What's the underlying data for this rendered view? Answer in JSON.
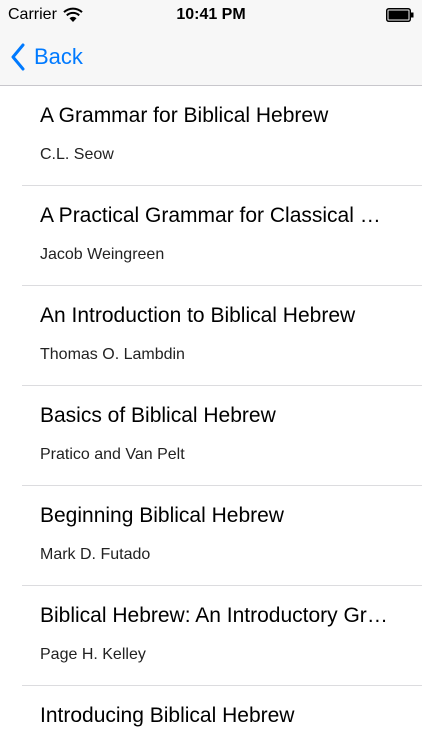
{
  "status_bar": {
    "carrier": "Carrier",
    "time": "10:41 PM",
    "wifi_icon": "wifi-icon",
    "battery_icon": "battery-icon"
  },
  "nav": {
    "back_label": "Back",
    "back_icon": "chevron-left-icon",
    "accent_color": "#007aff"
  },
  "books": [
    {
      "title": "A Grammar for Biblical Hebrew",
      "author": "C.L. Seow"
    },
    {
      "title": "A Practical Grammar for Classical Hebrew",
      "author": "Jacob Weingreen"
    },
    {
      "title": "An Introduction to Biblical Hebrew",
      "author": "Thomas O. Lambdin"
    },
    {
      "title": "Basics of Biblical Hebrew",
      "author": "Pratico and Van Pelt"
    },
    {
      "title": "Beginning Biblical Hebrew",
      "author": "Mark D. Futado"
    },
    {
      "title": "Biblical Hebrew: An Introductory Grammar",
      "author": "Page H. Kelley"
    },
    {
      "title": "Introducing Biblical Hebrew",
      "author": ""
    }
  ]
}
